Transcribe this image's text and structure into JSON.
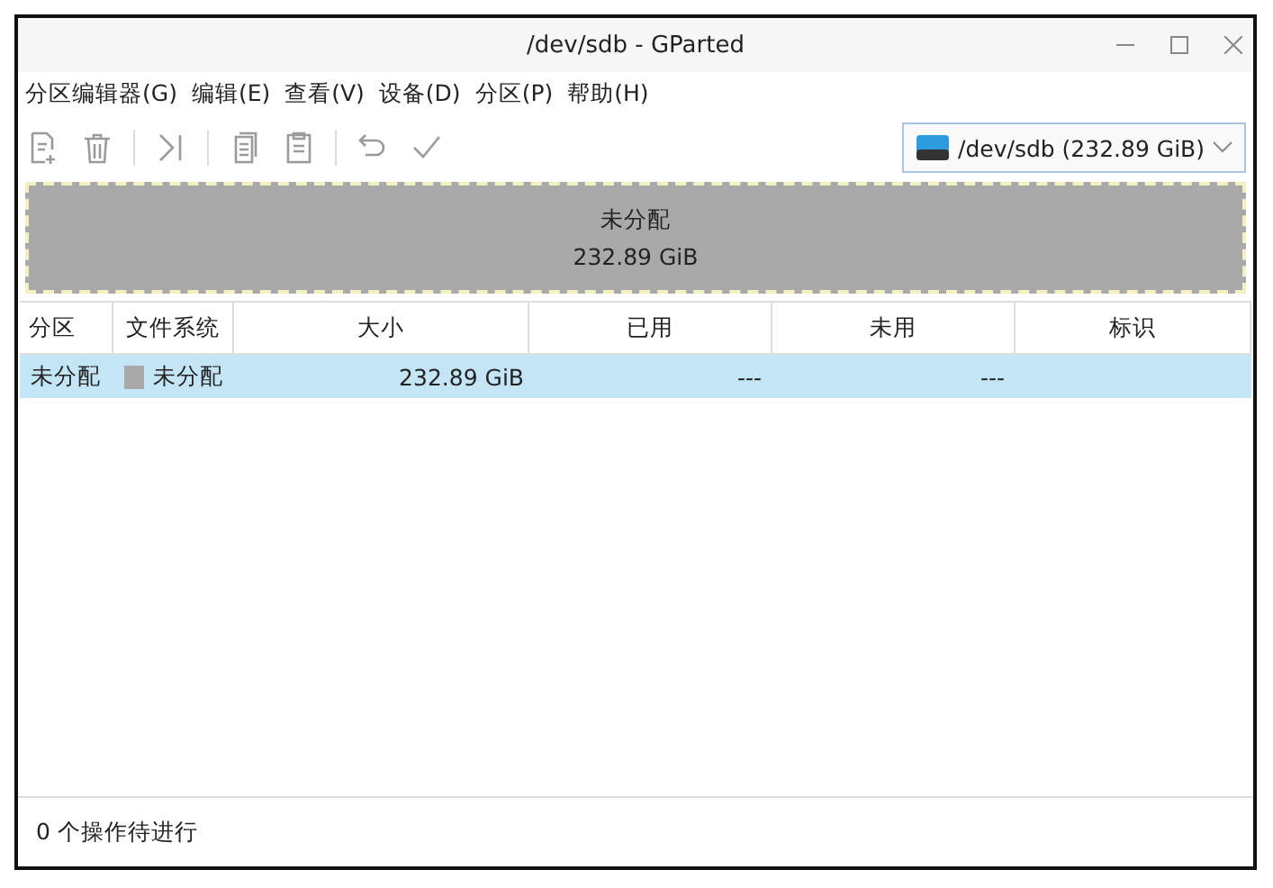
{
  "window": {
    "title": "/dev/sdb - GParted"
  },
  "menu": [
    "分区编辑器(G)",
    "编辑(E)",
    "查看(V)",
    "设备(D)",
    "分区(P)",
    "帮助(H)"
  ],
  "toolbar": {
    "device": "/dev/sdb (232.89 GiB)"
  },
  "disk_map": {
    "label": "未分配",
    "size": "232.89 GiB"
  },
  "table": {
    "columns": [
      "分区",
      "文件系统",
      "大小",
      "已用",
      "未用",
      "标识"
    ],
    "rows": [
      {
        "partition": "未分配",
        "filesystem": "未分配",
        "color": "#a9a9a9",
        "size": "232.89 GiB",
        "used": "---",
        "unused": "---",
        "selected": true
      }
    ]
  },
  "status_bar": "0 个操作待进行"
}
